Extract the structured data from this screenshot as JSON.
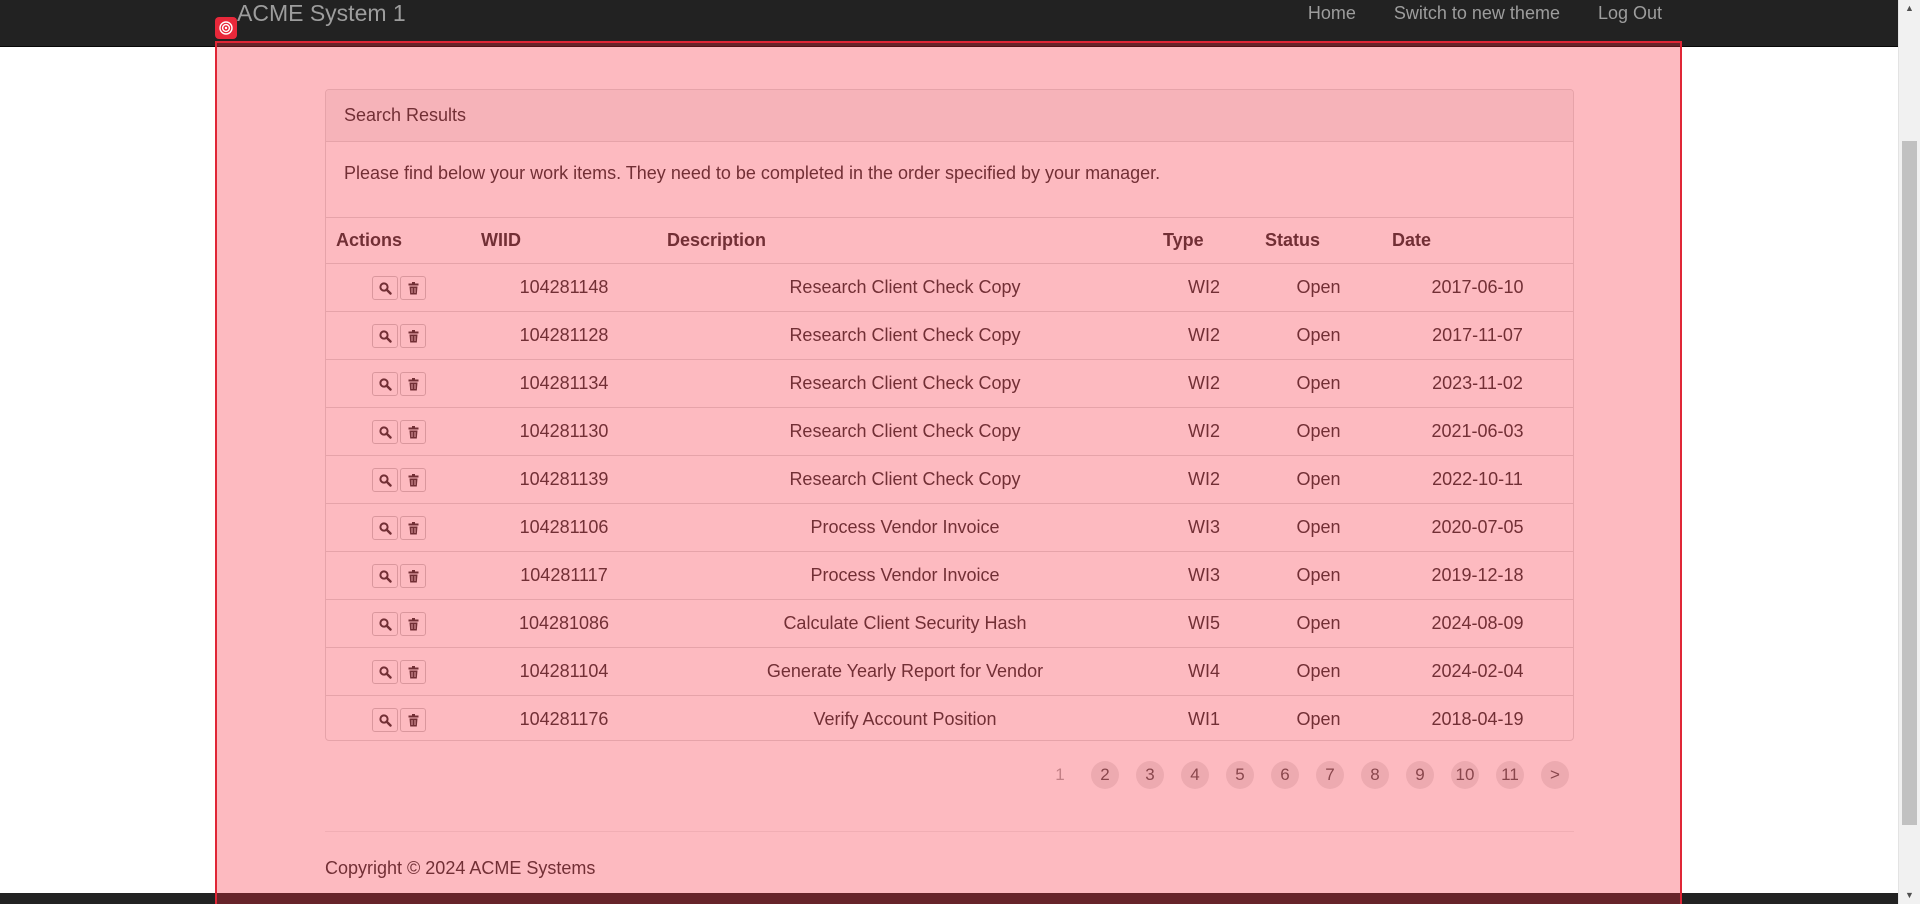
{
  "navbar": {
    "brand": "ACME System 1",
    "links": [
      "Home",
      "Switch to new theme",
      "Log Out"
    ]
  },
  "panel": {
    "heading": "Search Results",
    "message": "Please find below your work items. They need to be completed in the order specified by your manager."
  },
  "table": {
    "headers": [
      "Actions",
      "WIID",
      "Description",
      "Type",
      "Status",
      "Date"
    ],
    "rows": [
      {
        "wiid": "104281148",
        "description": "Research Client Check Copy",
        "type": "WI2",
        "status": "Open",
        "date": "2017-06-10"
      },
      {
        "wiid": "104281128",
        "description": "Research Client Check Copy",
        "type": "WI2",
        "status": "Open",
        "date": "2017-11-07"
      },
      {
        "wiid": "104281134",
        "description": "Research Client Check Copy",
        "type": "WI2",
        "status": "Open",
        "date": "2023-11-02"
      },
      {
        "wiid": "104281130",
        "description": "Research Client Check Copy",
        "type": "WI2",
        "status": "Open",
        "date": "2021-06-03"
      },
      {
        "wiid": "104281139",
        "description": "Research Client Check Copy",
        "type": "WI2",
        "status": "Open",
        "date": "2022-10-11"
      },
      {
        "wiid": "104281106",
        "description": "Process Vendor Invoice",
        "type": "WI3",
        "status": "Open",
        "date": "2020-07-05"
      },
      {
        "wiid": "104281117",
        "description": "Process Vendor Invoice",
        "type": "WI3",
        "status": "Open",
        "date": "2019-12-18"
      },
      {
        "wiid": "104281086",
        "description": "Calculate Client Security Hash",
        "type": "WI5",
        "status": "Open",
        "date": "2024-08-09"
      },
      {
        "wiid": "104281104",
        "description": "Generate Yearly Report for Vendor",
        "type": "WI4",
        "status": "Open",
        "date": "2024-02-04"
      },
      {
        "wiid": "104281176",
        "description": "Verify Account Position",
        "type": "WI1",
        "status": "Open",
        "date": "2018-04-19"
      }
    ],
    "row_icons": [
      "search-icon",
      "trash-icon"
    ]
  },
  "pagination": {
    "pages": [
      "1",
      "2",
      "3",
      "4",
      "5",
      "6",
      "7",
      "8",
      "9",
      "10",
      "11",
      ">"
    ],
    "active": "1"
  },
  "footer": {
    "copyright": "Copyright © 2024 ACME Systems"
  },
  "colors": {
    "navbar_bg": "#222222",
    "overlay": "#f8283c",
    "overlay_border": "#e02636"
  }
}
